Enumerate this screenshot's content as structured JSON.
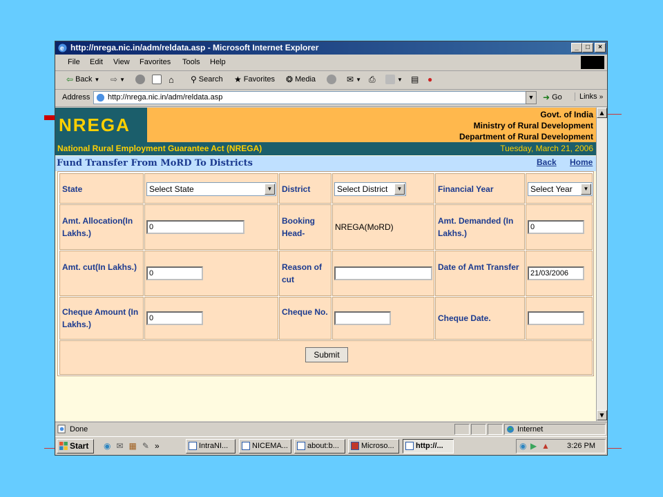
{
  "window": {
    "title": "http://nrega.nic.in/adm/reldata.asp - Microsoft Internet Explorer",
    "controls": [
      "_",
      "□",
      "×"
    ]
  },
  "menu": [
    "File",
    "Edit",
    "View",
    "Favorites",
    "Tools",
    "Help"
  ],
  "toolbar": {
    "back": "Back",
    "search": "Search",
    "favorites": "Favorites",
    "media": "Media"
  },
  "addressbar": {
    "label": "Address",
    "url": "http://nrega.nic.in/adm/reldata.asp",
    "go": "Go",
    "links": "Links"
  },
  "site": {
    "logo": "NREGA",
    "govt_lines": [
      "Govt. of India",
      "Ministry of Rural Development",
      "Department of Rural Development"
    ],
    "act_title": "National Rural Employment Guarantee Act (NREGA)",
    "date": "Tuesday, March 21, 2006",
    "page_title": "Fund Transfer From MoRD To Districts",
    "back_link": "Back",
    "home_link": "Home"
  },
  "form": {
    "state_label": "State",
    "state_value": "Select State",
    "district_label": "District",
    "district_value": "Select District",
    "fy_label": "Financial Year",
    "fy_value": "Select Year",
    "alloc_label": "Amt. Allocation(In Lakhs.)",
    "alloc_value": "0",
    "booking_label": "Booking Head-",
    "booking_value": "NREGA(MoRD)",
    "demanded_label": "Amt. Demanded (In Lakhs.)",
    "demanded_value": "0",
    "cut_label": "Amt. cut(In Lakhs.)",
    "cut_value": "0",
    "reason_label": "Reason of cut",
    "reason_value": "",
    "transfer_date_label": "Date of Amt Transfer",
    "transfer_date_value": "21/03/2006",
    "cheque_amt_label": "Cheque Amount (In Lakhs.)",
    "cheque_amt_value": "0",
    "cheque_no_label": "Cheque No.",
    "cheque_no_value": "",
    "cheque_date_label": "Cheque Date.",
    "cheque_date_value": "",
    "submit": "Submit"
  },
  "statusbar": {
    "status": "Done",
    "zone": "Internet"
  },
  "taskbar": {
    "start": "Start",
    "more": "»",
    "tasks": [
      "IntraNI...",
      "NICEMA...",
      "about:b...",
      "Microso...",
      "http://..."
    ],
    "clock": "3:26 PM"
  },
  "colors": {
    "desktop": "#66CCFF",
    "banner_teal": "#1B5E6B",
    "banner_orange": "#FFB84D",
    "logo_yellow": "#FFD000",
    "form_cell": "#FFE0C0",
    "label_blue": "#1B3A8F"
  }
}
